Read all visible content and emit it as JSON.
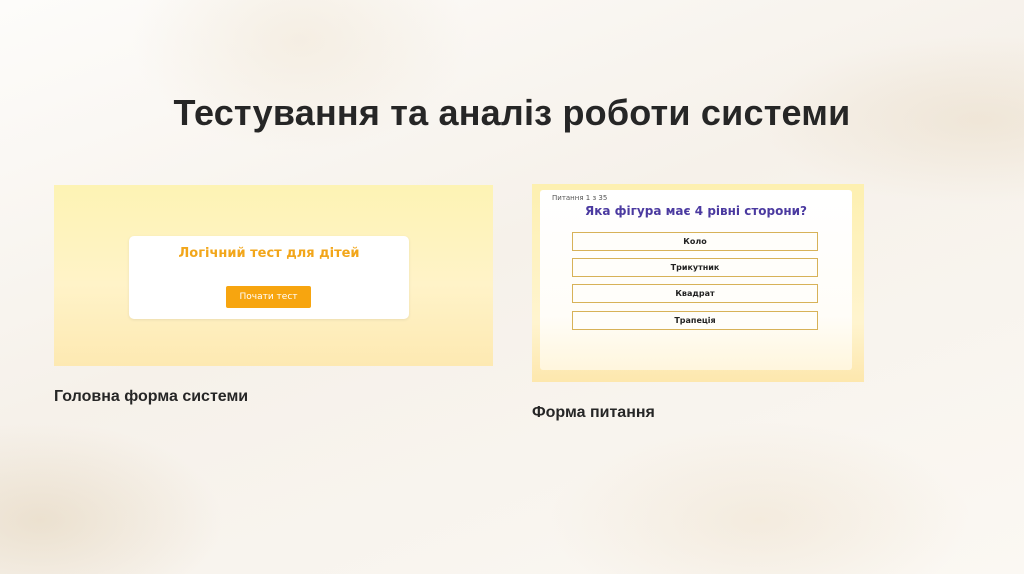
{
  "slide": {
    "title": "Тестування та аналіз роботи системи",
    "captions": {
      "main_form": "Головна форма системи",
      "question_form": "Форма питання"
    }
  },
  "main_form": {
    "heading": "Логічний тест для дітей",
    "start_button": "Почати тест"
  },
  "question_form": {
    "counter": "Питання 1 з 35",
    "question": "Яка фігура має 4 рівні сторони?",
    "answers": [
      "Коло",
      "Трикутник",
      "Квадрат",
      "Трапеція"
    ]
  },
  "colors": {
    "accent_orange": "#f7a50f",
    "question_purple": "#4b3aa0",
    "answer_border": "#d7b258"
  }
}
